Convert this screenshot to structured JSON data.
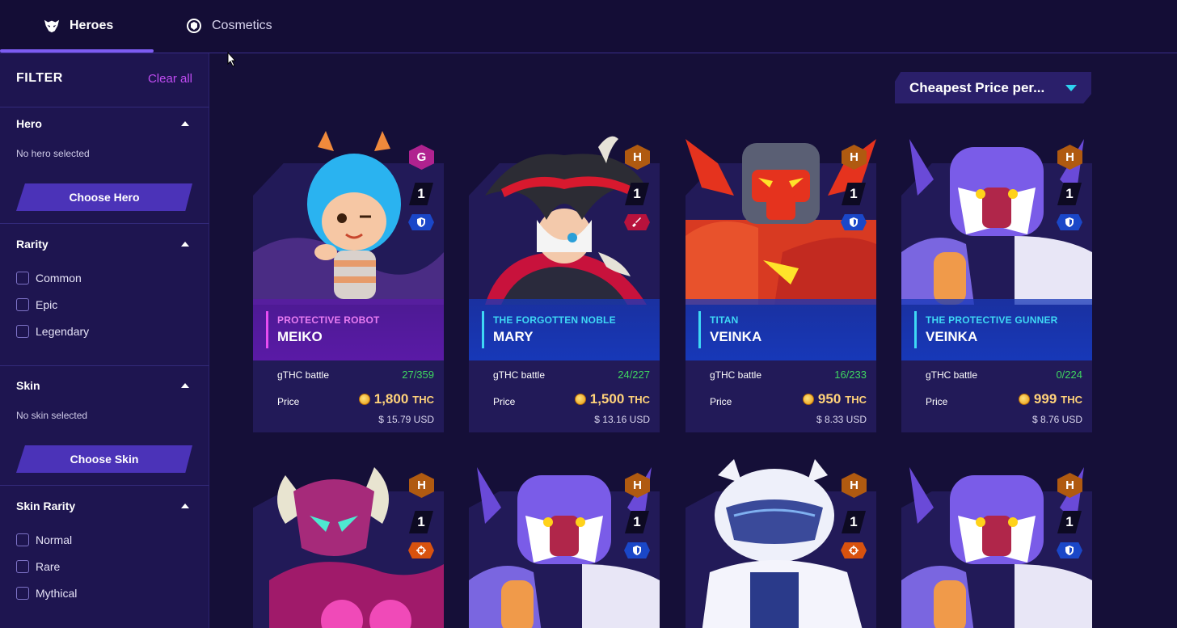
{
  "nav": {
    "tabs": [
      {
        "label": "Heroes",
        "active": true,
        "icon": "hero-mask-icon"
      },
      {
        "label": "Cosmetics",
        "active": false,
        "icon": "cosmetic-icon"
      }
    ]
  },
  "sidebar": {
    "title": "FILTER",
    "clear_all": "Clear all",
    "hero": {
      "label": "Hero",
      "empty": "No hero selected",
      "button": "Choose Hero"
    },
    "rarity": {
      "label": "Rarity",
      "options": [
        "Common",
        "Epic",
        "Legendary"
      ]
    },
    "skin": {
      "label": "Skin",
      "empty": "No skin selected",
      "button": "Choose Skin"
    },
    "skin_rarity": {
      "label": "Skin Rarity",
      "options": [
        "Normal",
        "Rare",
        "Mythical"
      ]
    }
  },
  "sort": {
    "label": "Cheapest Price per..."
  },
  "colors": {
    "accent": "#7d5cf2",
    "clear_all": "#c04cf2",
    "battle_green": "#3fd860",
    "price_gold": "#ffd27a",
    "band_purple": "#5a1aa6",
    "band_blue": "#1738b8"
  },
  "cards": [
    {
      "grade": "G",
      "level": "1",
      "class_icon": "shield-icon",
      "subtitle": "PROTECTIVE ROBOT",
      "name": "MEIKO",
      "battle_label": "gTHC battle",
      "battle": "27/359",
      "price_label": "Price",
      "price": "1,800",
      "currency": "THC",
      "usd": "$ 15.79 USD"
    },
    {
      "grade": "H",
      "level": "1",
      "class_icon": "sword-icon",
      "subtitle": "THE FORGOTTEN NOBLE",
      "name": "MARY",
      "battle_label": "gTHC battle",
      "battle": "24/227",
      "price_label": "Price",
      "price": "1,500",
      "currency": "THC",
      "usd": "$ 13.16 USD"
    },
    {
      "grade": "H",
      "level": "1",
      "class_icon": "shield-icon",
      "subtitle": "TITAN",
      "name": "VEINKA",
      "battle_label": "gTHC battle",
      "battle": "16/233",
      "price_label": "Price",
      "price": "950",
      "currency": "THC",
      "usd": "$ 8.33 USD"
    },
    {
      "grade": "H",
      "level": "1",
      "class_icon": "shield-icon",
      "subtitle": "THE PROTECTIVE GUNNER",
      "name": "VEINKA",
      "battle_label": "gTHC battle",
      "battle": "0/224",
      "price_label": "Price",
      "price": "999",
      "currency": "THC",
      "usd": "$ 8.76 USD"
    },
    {
      "grade": "H",
      "level": "1",
      "class_icon": "crosshair-icon"
    },
    {
      "grade": "H",
      "level": "1",
      "class_icon": "shield-icon"
    },
    {
      "grade": "H",
      "level": "1",
      "class_icon": "crosshair-icon"
    },
    {
      "grade": "H",
      "level": "1",
      "class_icon": "shield-icon"
    }
  ]
}
